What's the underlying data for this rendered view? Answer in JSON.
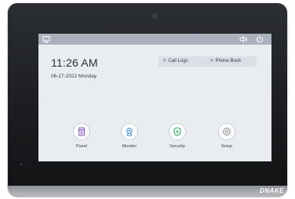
{
  "clock": {
    "time": "11:26 AM",
    "date": "06-27-2022 Monday"
  },
  "quick_links": {
    "call_logs": "Call Logs",
    "phone_book": "Phone Book"
  },
  "tiles": [
    {
      "label": "Panel",
      "icon": "intercom-panel-icon",
      "color": "#8a58b8"
    },
    {
      "label": "Monitor",
      "icon": "camera-monitor-icon",
      "color": "#3f8ee0"
    },
    {
      "label": "Security",
      "icon": "shield-icon",
      "color": "#2fb85b"
    },
    {
      "label": "Setup",
      "icon": "gear-icon",
      "color": "#8b9096"
    }
  ],
  "status_bar": {
    "icons": [
      "display-icon",
      "volume-icon",
      "power-icon"
    ]
  },
  "brand": "DNAKE",
  "colors": {
    "screen_bg": "#e9ecf0",
    "status_bar": "#a8b1bd",
    "bezel": "#1a1c1f"
  }
}
